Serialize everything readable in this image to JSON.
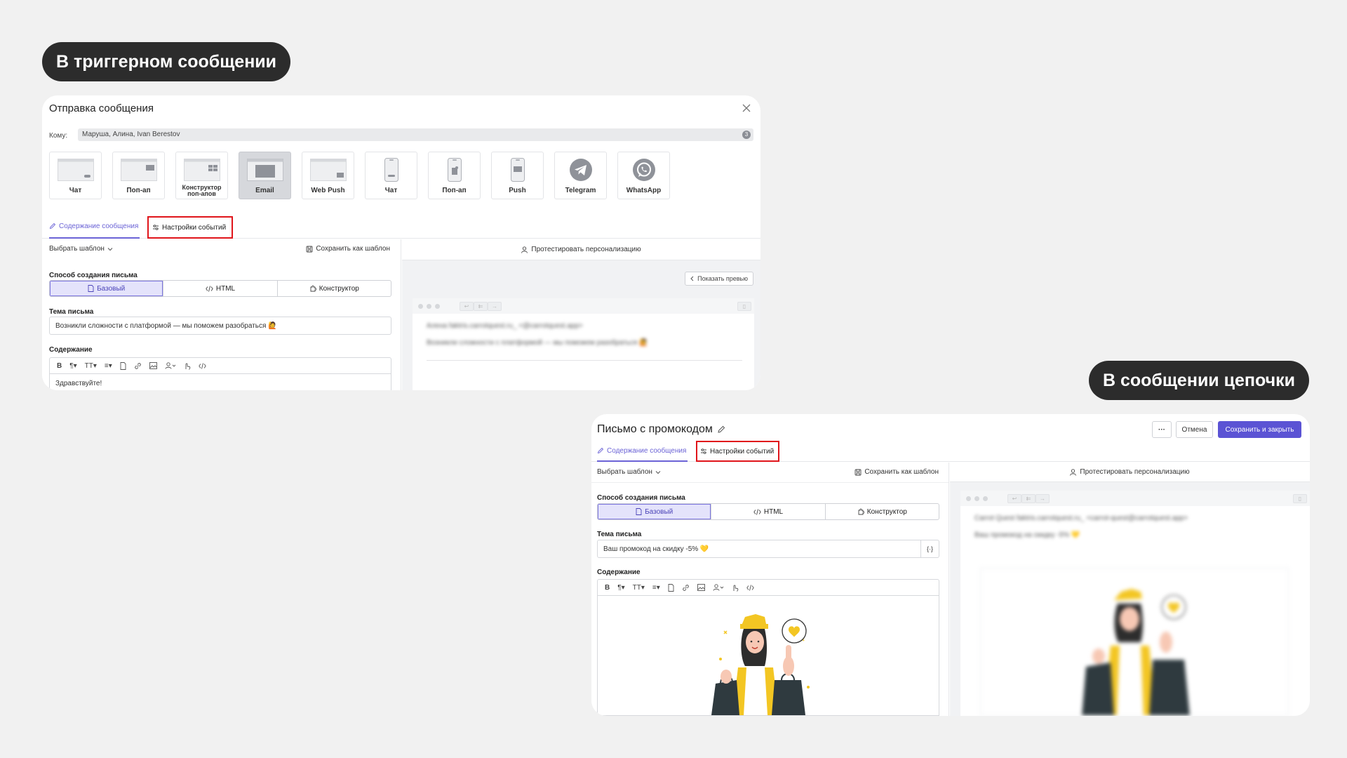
{
  "labels": {
    "trigger": "В триггерном сообщении",
    "chain": "В сообщении цепочки"
  },
  "trigger_dialog": {
    "title": "Отправка сообщения",
    "to_label": "Кому:",
    "recipients": "Маруша, Алина, Ivan Berestov",
    "recipients_count": "3",
    "channels": [
      {
        "label": "Чат",
        "icon": "desktop-chat-icon"
      },
      {
        "label": "Поп-ап",
        "icon": "desktop-popup-icon"
      },
      {
        "label": "Конструктор поп-апов",
        "icon": "popup-builder-icon"
      },
      {
        "label": "Email",
        "icon": "email-icon",
        "active": true
      },
      {
        "label": "Web Push",
        "icon": "web-push-icon"
      },
      {
        "label": "Чат",
        "icon": "mobile-chat-icon"
      },
      {
        "label": "Поп-ап",
        "icon": "mobile-popup-icon"
      },
      {
        "label": "Push",
        "icon": "mobile-push-icon"
      },
      {
        "label": "Telegram",
        "icon": "telegram-icon"
      },
      {
        "label": "WhatsApp",
        "icon": "whatsapp-icon"
      }
    ],
    "tabs": {
      "content": "Содержание сообщения",
      "events": "Настройки событий"
    },
    "choose_template": "Выбрать шаблон",
    "save_template": "Сохранить как шаблон",
    "test_personalization": "Протестировать персонализацию",
    "creation_method_label": "Способ создания письма",
    "methods": {
      "basic": "Базовый",
      "html": "HTML",
      "builder": "Конструктор"
    },
    "subject_label": "Тема письма",
    "subject": "Возникли сложности с платформой — мы поможем разобраться 🙋",
    "content_label": "Содержание",
    "content_first_line": "Здравствуйте!",
    "show_preview": "Показать превью",
    "preview_from": "Алена  faktris.carrotquest.ru_  <@carrotquest.app>",
    "preview_subject": "Возникли сложности с платформой — мы поможем разобраться 🙋"
  },
  "chain_editor": {
    "title": "Письмо с промокодом",
    "more": "···",
    "cancel": "Отмена",
    "save_close": "Сохранить и закрыть",
    "tabs": {
      "content": "Содержание сообщения",
      "events": "Настройки событий"
    },
    "choose_template": "Выбрать шаблон",
    "save_template": "Сохранить как шаблон",
    "test_personalization": "Протестировать персонализацию",
    "creation_method_label": "Способ создания письма",
    "methods": {
      "basic": "Базовый",
      "html": "HTML",
      "builder": "Конструктор"
    },
    "subject_label": "Тема письма",
    "subject": "Ваш промокод на скидку -5% 💛",
    "content_label": "Содержание",
    "preview_from": "Carrot Quest  faktris.carrotquest.ru_  <carrot-quest@carrotquest.app>",
    "preview_subject": "Ваш промокод на скидку -5% 💛"
  },
  "colors": {
    "accent": "#5b53d4",
    "highlight": "#e0151b",
    "pill": "#2c2c2c"
  }
}
